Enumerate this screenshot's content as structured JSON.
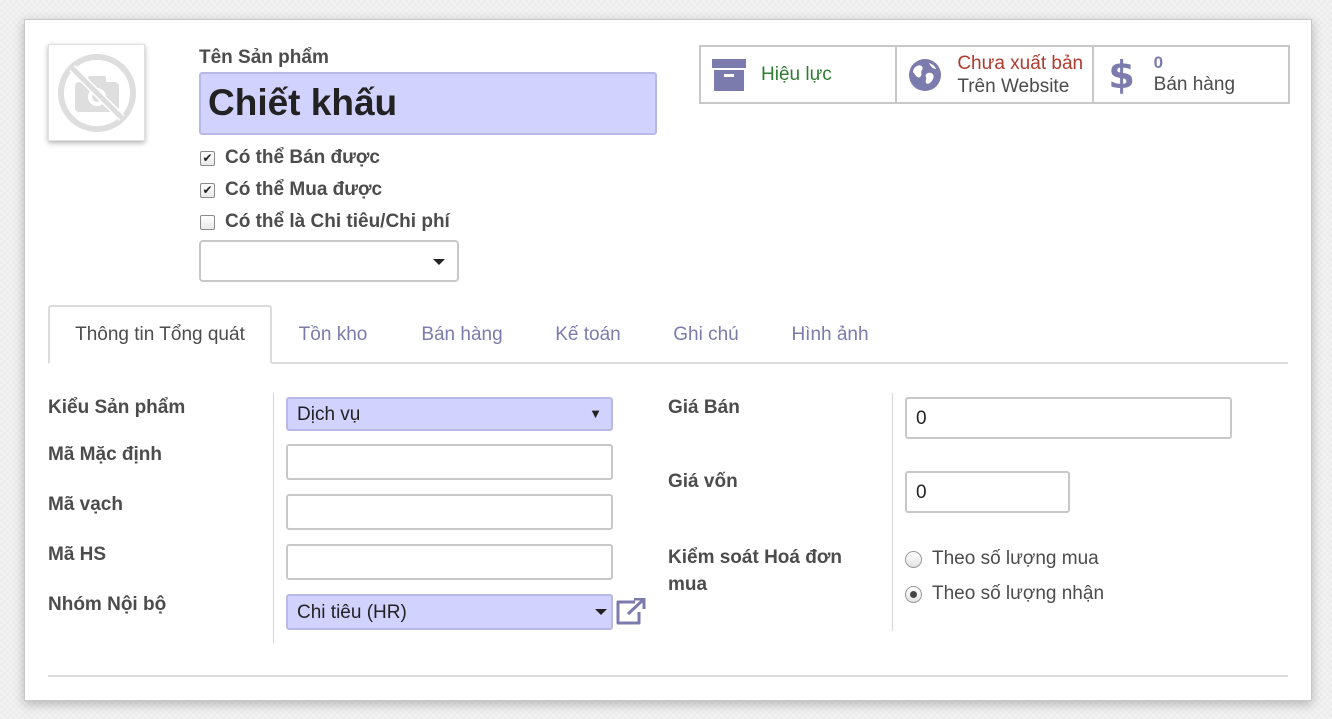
{
  "header": {
    "name_label": "Tên Sản phẩm",
    "name_value": "Chiết khấu",
    "checkboxes": [
      {
        "label": "Có thể Bán được",
        "checked": true
      },
      {
        "label": "Có thể Mua được",
        "checked": true
      },
      {
        "label": "Có thể là Chi tiêu/Chi phí",
        "checked": false
      }
    ],
    "extra_select_value": ""
  },
  "smart_buttons": {
    "active": {
      "label": "Hiệu lực",
      "icon": "archive-icon",
      "color": "#2e7d32"
    },
    "website": {
      "line1": "Chưa xuất bản",
      "line2": "Trên Website",
      "icon": "globe-icon",
      "line1_color": "#b03a2e"
    },
    "sales": {
      "count": "0",
      "label": "Bán hàng",
      "icon": "dollar-icon"
    }
  },
  "tabs": [
    {
      "label": "Thông tin Tổng quát",
      "active": true
    },
    {
      "label": "Tồn kho",
      "active": false
    },
    {
      "label": "Bán hàng",
      "active": false
    },
    {
      "label": "Kế toán",
      "active": false
    },
    {
      "label": "Ghi chú",
      "active": false
    },
    {
      "label": "Hình ảnh",
      "active": false
    }
  ],
  "left_fields": {
    "product_type": {
      "label": "Kiểu Sản phẩm",
      "value": "Dịch vụ"
    },
    "default_code": {
      "label": "Mã Mặc định",
      "value": ""
    },
    "barcode": {
      "label": "Mã vạch",
      "value": ""
    },
    "hs_code": {
      "label": "Mã HS",
      "value": ""
    },
    "internal_category": {
      "label": "Nhóm Nội bộ",
      "value": "Chi tiêu (HR)"
    }
  },
  "right_fields": {
    "sale_price": {
      "label": "Giá Bán",
      "value": "0"
    },
    "cost": {
      "label": "Giá vốn",
      "value": "0"
    },
    "purchase_control": {
      "label_line1": "Kiểm soát Hoá đơn",
      "label_line2": "mua",
      "options": [
        {
          "label": "Theo số lượng mua",
          "selected": false
        },
        {
          "label": "Theo số lượng nhận",
          "selected": true
        }
      ]
    }
  },
  "colors": {
    "accent": "#7c7bad",
    "highlight": "#d2d2ff",
    "icon": "#7c7bad"
  }
}
